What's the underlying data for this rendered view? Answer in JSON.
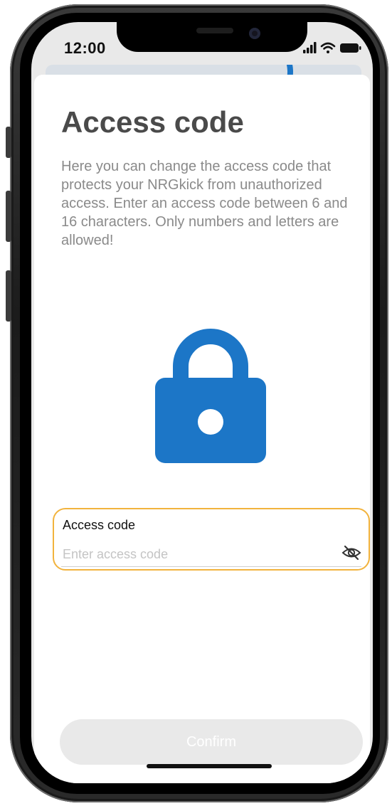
{
  "status_bar": {
    "time": "12:00",
    "signal_icon": "cellular-signal-icon",
    "wifi_icon": "wifi-icon",
    "battery_icon": "battery-icon"
  },
  "page": {
    "title": "Access code",
    "description": "Here you can change the access code that protects your NRGkick from unauthorized access. Enter an access code between 6 and 16 characters. Only numbers and letters are allowed!",
    "hero_icon": "lock-icon"
  },
  "form": {
    "label": "Access code",
    "value": "",
    "placeholder": "Enter access code",
    "visibility_icon": "eye-slash-icon"
  },
  "actions": {
    "confirm_label": "Confirm",
    "confirm_enabled": false
  },
  "colors": {
    "accent": "#1c76c7",
    "focus_border": "#f2b33d",
    "title": "#4a4a4a",
    "body_text": "#8a8a8a",
    "disabled_button": "#e9e9e9"
  }
}
